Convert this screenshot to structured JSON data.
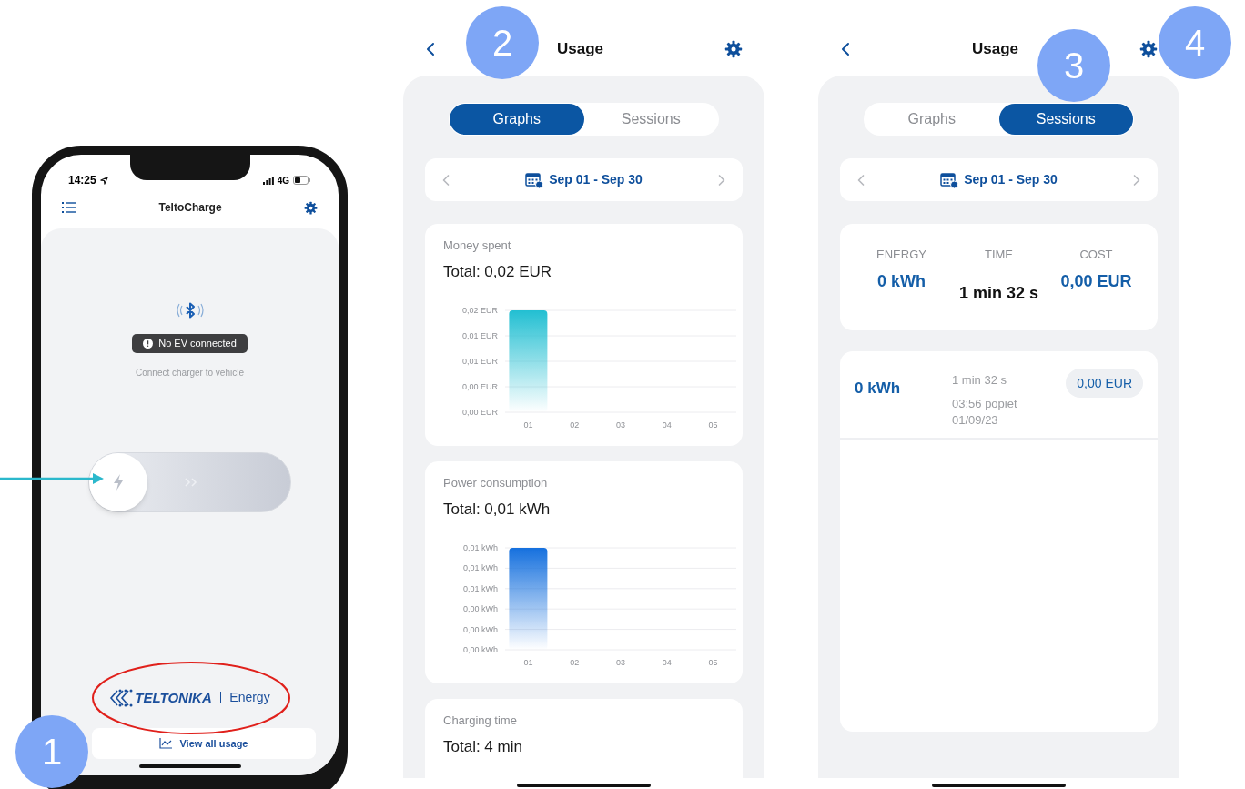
{
  "phone": {
    "status_time": "14:25",
    "network": "4G",
    "title": "TeltoCharge",
    "badge": "No EV connected",
    "charge_slider": {
      "level": 0
    },
    "hint": "Connect charger to vehicle",
    "logo": {
      "brand": "TELTONIKA",
      "product": "Energy"
    },
    "view_all_button": "View all usage"
  },
  "usage_graphs": {
    "title": "Usage",
    "tabs": [
      {
        "label": "Graphs",
        "selected": true
      },
      {
        "label": "Sessions",
        "selected": false
      }
    ],
    "date_range": "Sep 01 - Sep 30",
    "cards": [
      {
        "kind": "chart",
        "label": "Money spent",
        "total": "Total: 0,02 EUR",
        "chart_data": {
          "type": "bar",
          "categories": [
            "01",
            "02",
            "03",
            "04",
            "05"
          ],
          "series": [
            {
              "color": "#22bfd2",
              "values": [
                0.02,
                0,
                0,
                0,
                0
              ]
            }
          ],
          "grid": true,
          "ylim": [
            0,
            0.02
          ],
          "yticks": [
            {
              "value": 0,
              "label": "0,00 EUR"
            },
            {
              "value": 0.005,
              "label": "0,00 EUR"
            },
            {
              "value": 0.01,
              "label": "0,01 EUR"
            },
            {
              "value": 0.015,
              "label": "0,01 EUR"
            },
            {
              "value": 0.02,
              "label": "0,02 EUR"
            }
          ]
        }
      },
      {
        "kind": "chart",
        "label": "Power consumption",
        "total": "Total: 0,01 kWh",
        "chart_data": {
          "type": "bar",
          "categories": [
            "01",
            "02",
            "03",
            "04",
            "05"
          ],
          "series": [
            {
              "color": "#1570de",
              "values": [
                0.01,
                0,
                0,
                0,
                0
              ]
            }
          ],
          "grid": true,
          "ylim": [
            0,
            0.01
          ],
          "yticks": [
            {
              "value": 0,
              "label": "0,00 kWh"
            },
            {
              "value": 0.002,
              "label": "0,00 kWh"
            },
            {
              "value": 0.004,
              "label": "0,00 kWh"
            },
            {
              "value": 0.006,
              "label": "0,01 kWh"
            },
            {
              "value": 0.008,
              "label": "0,01 kWh"
            },
            {
              "value": 0.01,
              "label": "0,01 kWh"
            }
          ]
        }
      },
      {
        "kind": "text",
        "label": "Charging time",
        "total": "Total: 4 min"
      }
    ]
  },
  "usage_sessions": {
    "title": "Usage",
    "tabs": [
      {
        "label": "Graphs",
        "selected": false
      },
      {
        "label": "Sessions",
        "selected": true
      }
    ],
    "date_range": "Sep 01 - Sep 30",
    "summary": [
      {
        "label": "ENERGY",
        "value": "0 kWh",
        "kind": "accent"
      },
      {
        "label": "TIME",
        "value": "1 min 32 s",
        "kind": "plain"
      },
      {
        "label": "COST",
        "value": "0,00 EUR",
        "kind": "accent"
      }
    ],
    "sessions": [
      {
        "energy": "0 kWh",
        "duration": "1 min 32 s",
        "time": "03:56 popiet",
        "date": "01/09/23",
        "cost": "0,00 EUR"
      }
    ]
  },
  "callouts": [
    {
      "label": "1"
    },
    {
      "label": "2"
    },
    {
      "label": "3"
    },
    {
      "label": "4"
    }
  ]
}
